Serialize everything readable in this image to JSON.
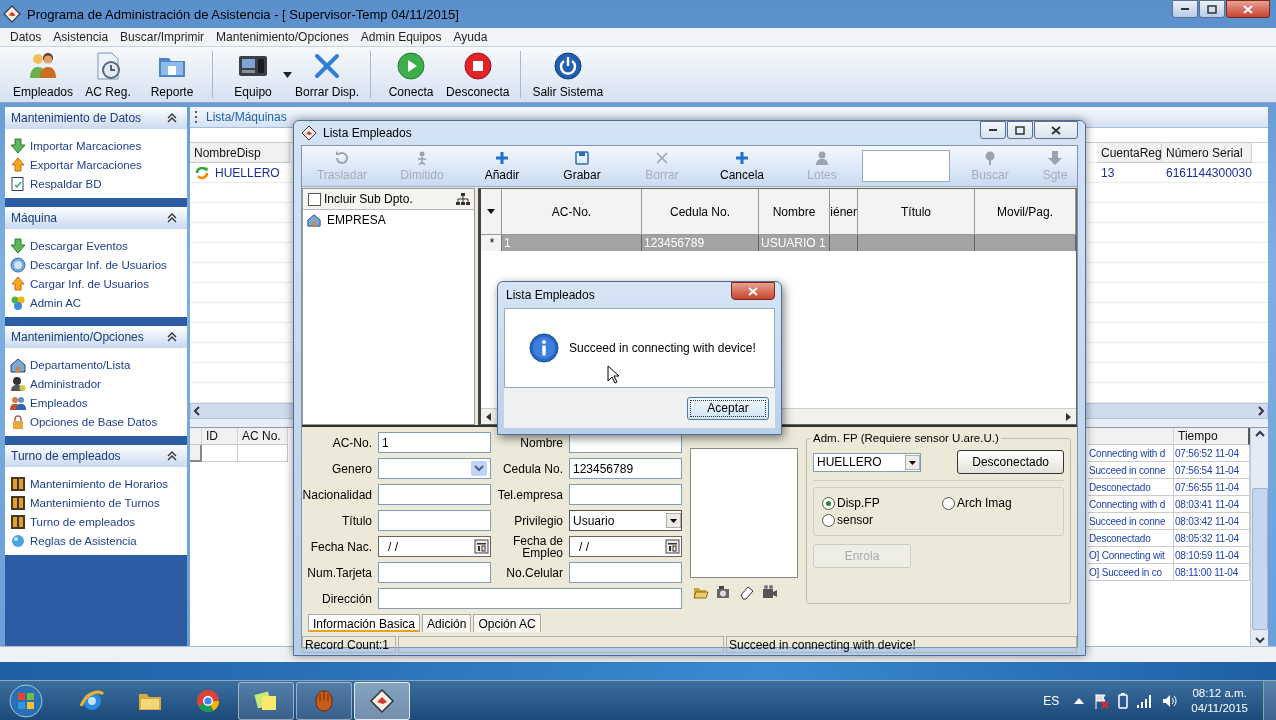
{
  "window": {
    "title": "Programa de Administración de Asistencia - [ Supervisor-Temp 04/11/2015]"
  },
  "menu": [
    "Datos",
    "Asistencia",
    "Buscar/Imprimir",
    "Mantenimiento/Opciones",
    "Admin Equipos",
    "Ayuda"
  ],
  "toolbar": [
    [
      {
        "label": "Empleados",
        "dropdown": false
      },
      {
        "label": "AC Reg.",
        "dropdown": false
      },
      {
        "label": "Reporte",
        "dropdown": false
      }
    ],
    [
      {
        "label": "Equipo",
        "dropdown": true
      },
      {
        "label": "Borrar Disp.",
        "dropdown": false
      }
    ],
    [
      {
        "label": "Conecta",
        "dropdown": false
      },
      {
        "label": "Desconecta",
        "dropdown": false
      }
    ],
    [
      {
        "label": "Salir Sistema",
        "dropdown": false
      }
    ]
  ],
  "sidebar": {
    "groups": [
      {
        "title": "Mantenimiento de Datos",
        "expanded": true,
        "items": [
          "Importar Marcaciones",
          "Exportar Marcaciones",
          "Respaldar BD"
        ]
      },
      {
        "title": "Máquina",
        "expanded": true,
        "items": [
          "Descargar Eventos",
          "Descargar Inf. de Usuarios",
          "Cargar Inf. de Usuarios",
          "Admin AC"
        ]
      },
      {
        "title": "Mantenimiento/Opciones",
        "expanded": true,
        "items": [
          "Departamento/Lista",
          "Administrador",
          "Empleados",
          "Opciones de Base Datos"
        ]
      },
      {
        "title": "Turno de empleados",
        "expanded": true,
        "items": [
          "Mantenimiento de Horarios",
          "Mantenimiento de Turnos",
          "Turno de empleados",
          "Reglas de Asistencia"
        ]
      }
    ]
  },
  "machines_panel": {
    "title": "Lista/Máquinas",
    "devices": {
      "columns": [
        "NombreDisp",
        "CuentaReg",
        "Número Serial"
      ],
      "rows": [
        [
          "HUELLERO",
          "13",
          "6161144300030"
        ]
      ]
    },
    "records": {
      "columns": [
        "ID",
        "AC No."
      ]
    },
    "log": {
      "time_header": "Tiempo",
      "rows": [
        {
          "message": "Connecting with d",
          "time": "07:56:52 11-04"
        },
        {
          "message": "Succeed in conne",
          "time": "07:56:54 11-04"
        },
        {
          "message": "Desconectado",
          "time": "07:56:55 11-04"
        },
        {
          "message": "Connecting with d",
          "time": "08:03:41 11-04"
        },
        {
          "message": "Succeed in conne",
          "time": "08:03:42 11-04"
        },
        {
          "message": "Desconectado",
          "time": "08:05:32 11-04"
        },
        {
          "message": "O] Connecting wit",
          "time": "08:10:59 11-04"
        },
        {
          "message": "O] Succeed in co",
          "time": "08:11:00 11-04"
        }
      ]
    }
  },
  "employee_window": {
    "title": "Lista Empleados",
    "toolbar": [
      {
        "label": "Trasladar",
        "disabled": true
      },
      {
        "label": "Dimitido",
        "disabled": true
      },
      {
        "label": "Añadir",
        "disabled": false
      },
      {
        "label": "Grabar",
        "disabled": false
      },
      {
        "label": "Borrar",
        "disabled": true
      },
      {
        "label": "Cancela",
        "disabled": false
      },
      {
        "label": "Lotes",
        "disabled": true
      },
      {
        "label": "Buscar",
        "disabled": true
      },
      {
        "label": "Sgte",
        "disabled": true
      }
    ],
    "tree": {
      "include_sub": {
        "label": "Incluir Sub Dpto.",
        "checked": false
      },
      "items": [
        "EMPRESA"
      ]
    },
    "grid": {
      "columns": [
        "AC-No.",
        "Cedula No.",
        "Nombre",
        "iéner",
        "Título",
        "Movil/Pag."
      ],
      "rows": [
        {
          "marker": "*",
          "cells": [
            "1",
            "123456789",
            "USUARIO 1"
          ],
          "selected": true
        }
      ]
    },
    "form": {
      "fields": [
        {
          "label": "AC-No.",
          "kind": "text",
          "value": "1"
        },
        {
          "label": "Nombre",
          "kind": "text"
        },
        {
          "label": "Genero",
          "kind": "combo"
        },
        {
          "label": "Cedula No.",
          "kind": "text",
          "value": "123456789"
        },
        {
          "label": "Nacionalidad",
          "kind": "text"
        },
        {
          "label": "Tel.empresa",
          "kind": "text"
        },
        {
          "label": "Título",
          "kind": "text"
        },
        {
          "label": "Privilegio",
          "kind": "select",
          "value": "Usuario"
        },
        {
          "label": "Fecha Nac.",
          "kind": "date",
          "value": "/ /"
        },
        {
          "label": "Fecha de Empleo",
          "kind": "date",
          "value": "/ /"
        },
        {
          "label": "Num.Tarjeta",
          "kind": "text"
        },
        {
          "label": "No.Celular",
          "kind": "text"
        },
        {
          "label": "Dirección",
          "kind": "text"
        }
      ]
    },
    "fp": {
      "legend": "Adm. FP (Requiere sensor U.are.U.)",
      "device": "HUELLERO",
      "status_button": "Desconectado",
      "options": [
        {
          "label": "Disp.FP",
          "selected": true
        },
        {
          "label": "Arch Imag",
          "selected": false
        },
        {
          "label": "sensor",
          "selected": false
        }
      ],
      "enroll": {
        "label": "Enrola",
        "disabled": true
      }
    },
    "tabs": [
      {
        "label": "Información Basica",
        "selected": true
      },
      {
        "label": "Adición",
        "selected": false
      },
      {
        "label": "Opción AC",
        "selected": false
      }
    ],
    "status": {
      "left": "Record Count:1",
      "right": "Succeed in connecting with device!"
    }
  },
  "dialog": {
    "title": "Lista Empleados",
    "message": "Succeed in connecting with device!",
    "button": "Aceptar"
  },
  "taskbar": {
    "apps": [
      {
        "running": false,
        "selected": false
      },
      {
        "running": false,
        "selected": false
      },
      {
        "running": false,
        "selected": false
      },
      {
        "running": true,
        "selected": false
      },
      {
        "running": true,
        "selected": false
      },
      {
        "running": true,
        "selected": true
      }
    ],
    "language": "ES",
    "time": "08:12 a.m.",
    "date": "04/11/2015"
  }
}
